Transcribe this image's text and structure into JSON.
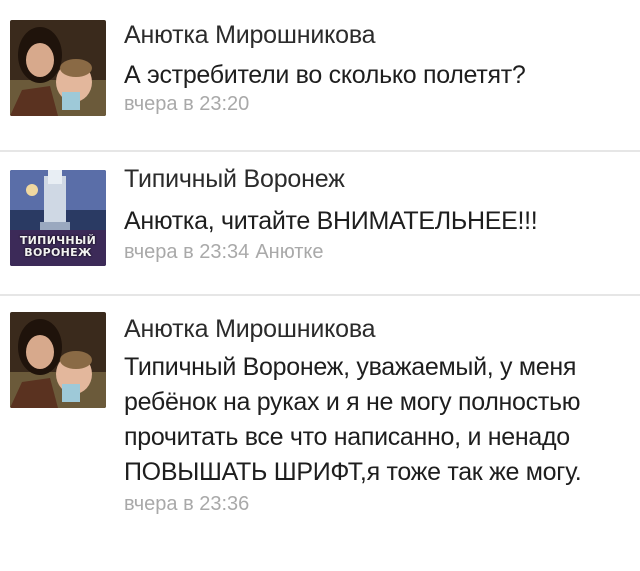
{
  "comments": [
    {
      "author": "Анютка Мирошникова",
      "text": "А эстребители во сколько полетят?",
      "time": "вчера в 23:20",
      "reply_to": ""
    },
    {
      "author": "Типичный Воронеж",
      "text": "Анютка, читайте ВНИМАТЕЛЬНЕЕ!!!",
      "time": "вчера в 23:34",
      "reply_to": "Анютке",
      "avatar_text_1": "ТИПИЧНЫЙ",
      "avatar_text_2": "ВОРОНЕЖ"
    },
    {
      "author": "Анютка Мирошникова",
      "text": "Типичный Воронеж, уважаемый, у меня ребёнок на руках и я не могу полностью прочитать все что написанно, и ненадо ПОВЫШАТЬ ШРИФТ,я тоже так же могу.",
      "time": "вчера в 23:36",
      "reply_to": ""
    }
  ],
  "colors": {
    "meta": "#a9a9a9",
    "divider": "#e6e6e6"
  }
}
